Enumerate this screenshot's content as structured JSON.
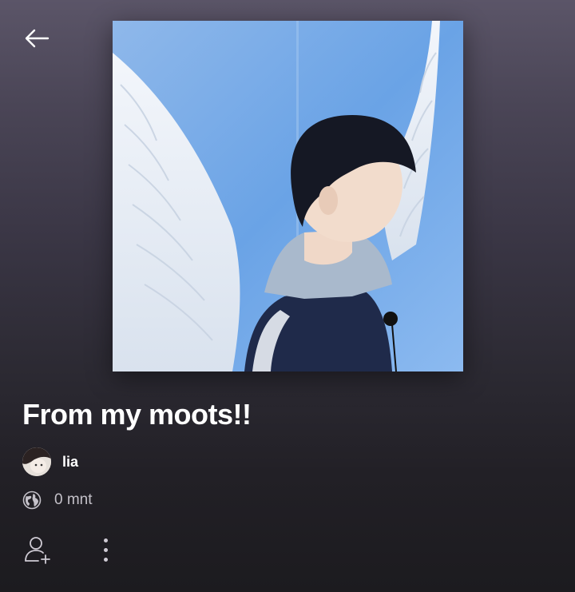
{
  "playlist": {
    "title": "From my moots!!",
    "owner": "lia",
    "duration": "0 mnt"
  },
  "icons": {
    "back": "arrow-left-icon",
    "globe": "globe-icon",
    "follow": "add-user-icon",
    "more": "more-vertical-icon"
  },
  "colors": {
    "background_top": "#5b5568",
    "background_bottom": "#1c1b1f",
    "text_primary": "#ffffff",
    "text_secondary": "#c4c1c9"
  }
}
